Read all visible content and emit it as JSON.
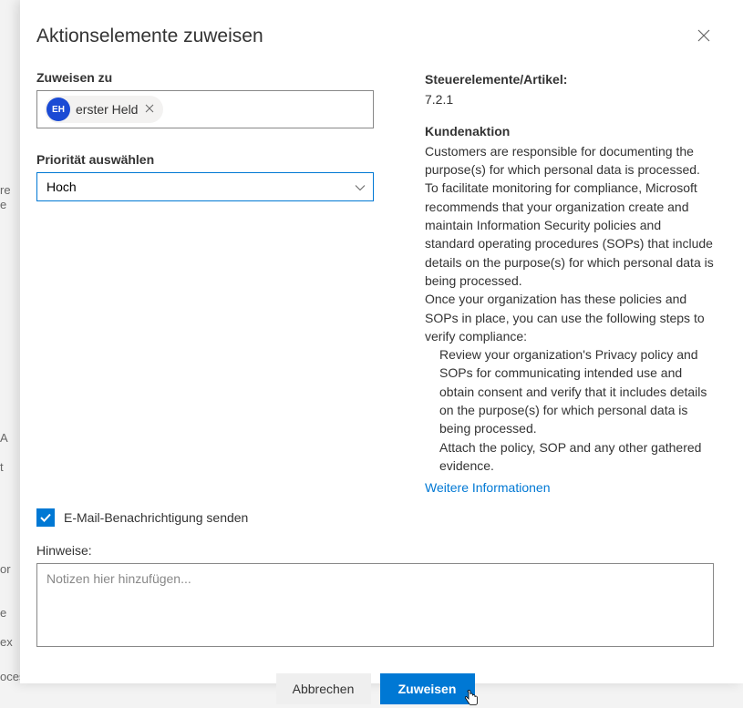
{
  "modal": {
    "title": "Aktionselemente zuweisen",
    "assign_label": "Zuweisen zu",
    "person": {
      "initials": "EH",
      "name": "erster Held"
    },
    "priority_label": "Priorität auswählen",
    "priority_value": "Hoch",
    "email_checkbox_label": "E-Mail-Benachrichtigung senden",
    "notes_label": "Hinweise:",
    "notes_placeholder": "Notizen hier hinzufügen...",
    "cancel": "Abbrechen",
    "assign": "Zuweisen"
  },
  "details": {
    "controls_label": "Steuerelemente/Artikel:",
    "controls_value": "7.2.1",
    "action_label": "Kundenaktion",
    "p1": "Customers are responsible for documenting the purpose(s) for which personal data is processed. To facilitate monitoring for compliance, Microsoft recommends that your organization create and maintain Information Security policies and standard operating procedures (SOPs) that include details on the purpose(s) for which personal data is being processed.",
    "p2": "Once your organization has these policies and SOPs in place, you can use the following steps to verify compliance:",
    "step1": "Review your organization's Privacy policy and SOPs for communicating intended use and obtain consent and verify that it includes details on the purpose(s) for which personal data is being processed.",
    "step2": "Attach the policy, SOP and any other gathered evidence.",
    "more_link": "Weitere Informationen"
  },
  "bg": {
    "f1": "re",
    "f2": "e",
    "f3": "A",
    "f4": "t",
    "f5": "or",
    "f6": "e",
    "f7": "ex",
    "f8": "ocessing by Union or Member"
  }
}
